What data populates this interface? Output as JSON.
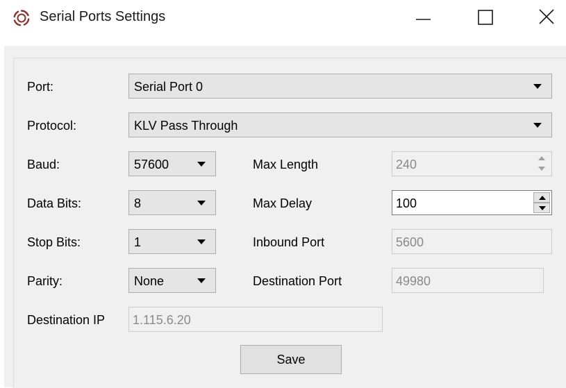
{
  "window": {
    "title": "Serial Ports Settings",
    "icon": "app-logo-icon",
    "controls": {
      "minimize": "minimize-icon",
      "maximize": "maximize-icon",
      "close": "close-icon"
    }
  },
  "form": {
    "port": {
      "label": "Port:",
      "value": "Serial Port 0"
    },
    "protocol": {
      "label": "Protocol:",
      "value": "KLV Pass Through"
    },
    "baud": {
      "label": "Baud:",
      "value": "57600"
    },
    "data_bits": {
      "label": "Data Bits:",
      "value": "8"
    },
    "stop_bits": {
      "label": "Stop Bits:",
      "value": "1"
    },
    "parity": {
      "label": "Parity:",
      "value": "None"
    },
    "destination_ip": {
      "label": "Destination IP",
      "value": "1.115.6.20"
    },
    "max_length": {
      "label": "Max Length",
      "value": "240"
    },
    "max_delay": {
      "label": "Max Delay",
      "value": "100"
    },
    "inbound_port": {
      "label": "Inbound Port",
      "value": "5600"
    },
    "destination_port": {
      "label": "Destination Port",
      "value": "49980"
    }
  },
  "save_label": "Save",
  "colors": {
    "logo": "#8b2e2e",
    "panel_bg": "#f0f0f0",
    "combo_bg": "#e5e5e5",
    "disabled_text": "#8a8a8a"
  }
}
